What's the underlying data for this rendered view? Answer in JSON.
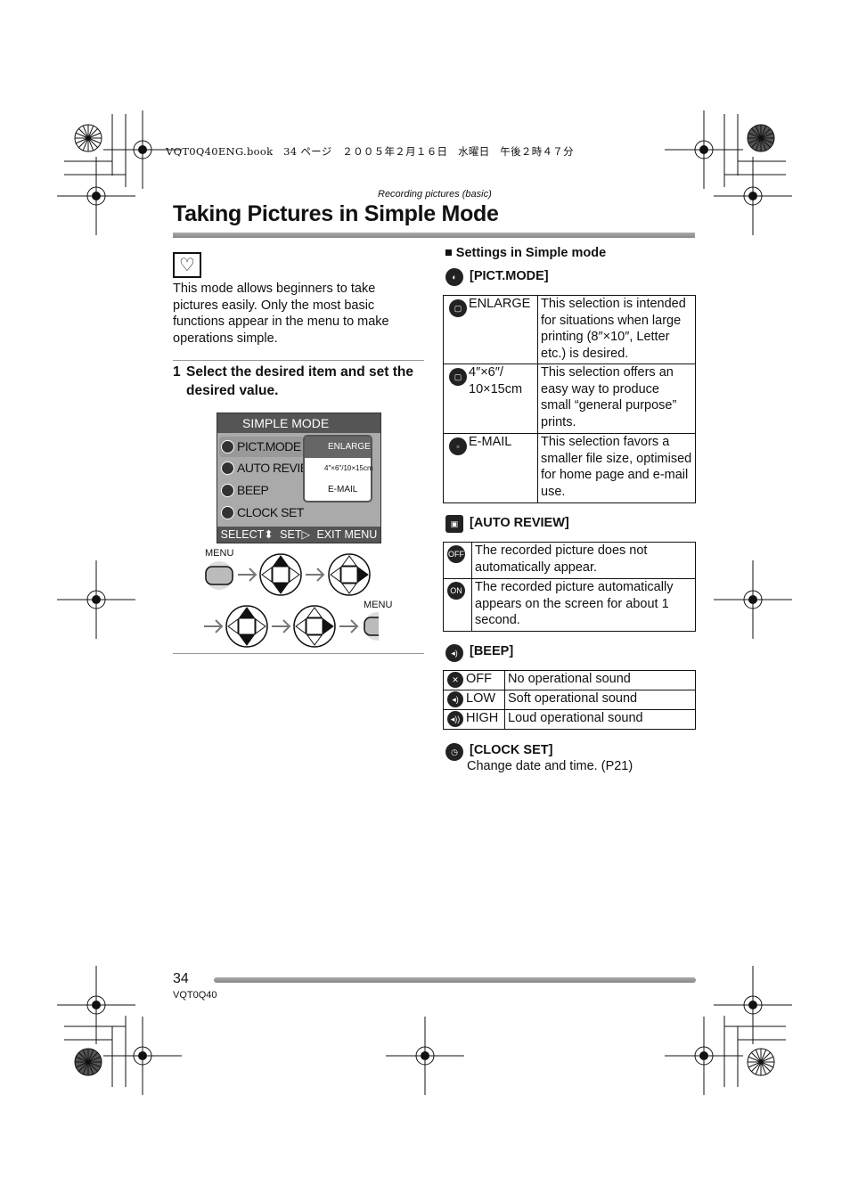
{
  "print_header": "VQT0Q40ENG.book　34 ページ　２００５年２月１６日　水曜日　午後２時４７分",
  "section": "Recording pictures (basic)",
  "title": "Taking Pictures in Simple Mode",
  "mode_icon": "heart-icon",
  "intro": "This mode allows beginners to take pictures easily. Only the most basic functions appear in the menu to make operations simple.",
  "step": {
    "number": "1",
    "text": "Select the desired item and set the desired value."
  },
  "screen": {
    "header": "SIMPLE MODE",
    "items": [
      "PICT.MODE",
      "AUTO REVIE",
      "BEEP",
      "CLOCK SET"
    ],
    "popup": [
      "ENLARGE",
      "4\"×6\"/10×15cm",
      "E-MAIL"
    ],
    "footer": [
      "SELECT⬍",
      "SET▷",
      "EXIT MENU"
    ]
  },
  "button_labels": {
    "menu1": "MENU",
    "menu2": "MENU"
  },
  "settings_heading": "■ Settings in Simple mode",
  "pict_mode": {
    "heading": "[PICT.MODE]",
    "rows": [
      {
        "name": "ENLARGE",
        "desc": "This selection is intended for situations when large printing (8″×10″, Letter etc.) is desired."
      },
      {
        "name": "4″×6″/ 10×15cm",
        "desc": "This selection offers an easy way to produce small “general purpose” prints."
      },
      {
        "name": "E-MAIL",
        "desc": "This selection favors a smaller file size, optimised for home page and e-mail use."
      }
    ]
  },
  "auto_review": {
    "heading": "[AUTO REVIEW]",
    "rows": [
      {
        "icon": "OFF",
        "desc": "The recorded picture does not automatically appear."
      },
      {
        "icon": "ON",
        "desc": "The recorded picture automatically appears on the screen for about 1 second."
      }
    ]
  },
  "beep": {
    "heading": "[BEEP]",
    "rows": [
      {
        "name": "OFF",
        "desc": "No operational sound"
      },
      {
        "name": "LOW",
        "desc": "Soft operational sound"
      },
      {
        "name": "HIGH",
        "desc": "Loud operational sound"
      }
    ]
  },
  "clock_set": {
    "heading": "[CLOCK SET]",
    "desc": "Change date and time. (P21)"
  },
  "page_number": "34",
  "doc_code": "VQT0Q40"
}
